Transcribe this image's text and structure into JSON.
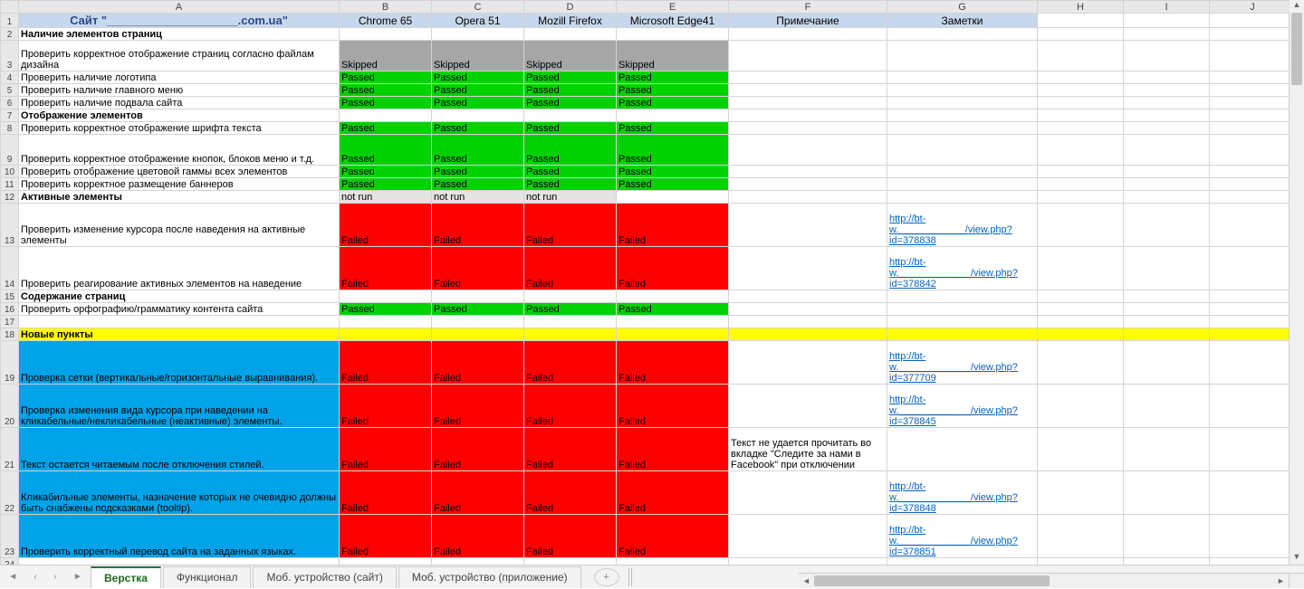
{
  "columns": [
    "A",
    "B",
    "C",
    "D",
    "E",
    "F",
    "G",
    "H",
    "I",
    "J"
  ],
  "header": {
    "title": "Сайт \"____________________.com.ua\"",
    "b": "Chrome 65",
    "c": "Opera  51",
    "d": "Mozill Firefox",
    "e": "Microsoft Edge41",
    "f": "Примечание",
    "g": "Заметки"
  },
  "rows": [
    {
      "n": 2,
      "a": "Наличие элементов страниц",
      "aCls": "bold"
    },
    {
      "n": 3,
      "a": "Проверить корректное отображение страниц согласно файлам дизайна",
      "tall": true,
      "b": "Skipped",
      "c": "Skipped",
      "d": "Skipped",
      "e": "Skipped",
      "bcCls": "gray"
    },
    {
      "n": 4,
      "a": "Проверить наличие логотипа",
      "b": "Passed",
      "c": "Passed",
      "d": "Passed",
      "e": "Passed",
      "bcCls": "green"
    },
    {
      "n": 5,
      "a": "Проверить наличие главного меню",
      "b": "Passed",
      "c": "Passed",
      "d": "Passed",
      "e": "Passed",
      "bcCls": "green"
    },
    {
      "n": 6,
      "a": "Проверить наличие подвала сайта",
      "b": "Passed",
      "c": "Passed",
      "d": "Passed",
      "e": "Passed",
      "bcCls": "green"
    },
    {
      "n": 7,
      "a": "Отображение элементов",
      "aCls": "bold"
    },
    {
      "n": 8,
      "a": "Проверить корректное отображение шрифта текста",
      "b": "Passed",
      "c": "Passed",
      "d": "Passed",
      "e": "Passed",
      "bcCls": "green"
    },
    {
      "n": 9,
      "a": "Проверить корректное отображение кнопок, блоков меню и т.д.",
      "tall": true,
      "b": "Passed",
      "c": "Passed",
      "d": "Passed",
      "e": "Passed",
      "bcCls": "green"
    },
    {
      "n": 10,
      "a": "Проверить отображение цветовой гаммы всех элементов",
      "b": "Passed",
      "c": "Passed",
      "d": "Passed",
      "e": "Passed",
      "bcCls": "green"
    },
    {
      "n": 11,
      "a": "Проверить корректное размещение баннеров",
      "b": "Passed",
      "c": "Passed",
      "d": "Passed",
      "e": "Passed",
      "bcCls": "green"
    },
    {
      "n": 12,
      "a": "Активные элементы",
      "aCls": "bold",
      "b": "not run",
      "c": "not run",
      "d": "not run",
      "bcCls": "ltgray",
      "eCls": ""
    },
    {
      "n": 13,
      "a": "Проверить изменение курсора после наведения на активные элементы",
      "tall2": true,
      "b": "Failed",
      "c": "Failed",
      "d": "Failed",
      "e": "Failed",
      "bcCls": "red",
      "g": "http://bt-w.____________/view.php?id=378838"
    },
    {
      "n": 14,
      "a": "Проверить реагирование активных элементов на наведение",
      "tall2": true,
      "b": "Failed",
      "c": "Failed",
      "d": "Failed",
      "e": "Failed",
      "bcCls": "red",
      "g": "http://bt-w._____________/view.php?id=378842"
    },
    {
      "n": 15,
      "a": "Содержание страниц",
      "aCls": "bold"
    },
    {
      "n": 16,
      "a": "Проверить орфографию/грамматику контента сайта",
      "b": "Passed",
      "c": "Passed",
      "d": "Passed",
      "e": "Passed",
      "bcCls": "green"
    },
    {
      "n": 17,
      "a": ""
    },
    {
      "n": 18,
      "a": "Новые пункты",
      "aCls": "bold",
      "rowCls": "yellow"
    },
    {
      "n": 19,
      "a": "Проверка сетки (вертикальные/горизонтальные выравнивания).",
      "tall2": true,
      "aCls": "blue",
      "b": "Failed",
      "c": "Failed",
      "d": "Failed",
      "e": "Failed",
      "bcCls": "red",
      "g": "http://bt-w._____________/view.php?id=377709"
    },
    {
      "n": 20,
      "a": "Проверка изменения вида курсора при наведении на кликабельные/некликабельные (неактивные) элементы.",
      "tall2": true,
      "aCls": "blue",
      "b": "Failed",
      "c": "Failed",
      "d": "Failed",
      "e": "Failed",
      "bcCls": "red",
      "g": "http://bt-w._____________/view.php?id=378845"
    },
    {
      "n": 21,
      "a": "Текст остается читаемым после отключения стилей.",
      "tall2": true,
      "aCls": "blue",
      "b": "Failed",
      "c": "Failed",
      "d": "Failed",
      "e": "Failed",
      "bcCls": "red",
      "f": "Текст не удается прочитать во вкладке \"Следите за нами в Facebook\" при отключении"
    },
    {
      "n": 22,
      "a": "Кликабильные элементы, назначение которых не очевидно должны быть снабжены подсказками (tooltip).",
      "tall2": true,
      "aCls": "blue",
      "b": "Failed",
      "c": "Failed",
      "d": "Failed",
      "e": "Failed",
      "bcCls": "red",
      "g": "http://bt-w._____________/view.php?id=378848"
    },
    {
      "n": 23,
      "a": "Проверить корректный перевод сайта на заданных языках.",
      "tall2": true,
      "aCls": "blue",
      "b": "Failed",
      "c": "Failed",
      "d": "Failed",
      "e": "Failed",
      "bcCls": "red",
      "g": "http://bt-w._____________/view.php?id=378851",
      "eBottom": true
    },
    {
      "n": 24,
      "a": ""
    }
  ],
  "tabs": [
    {
      "label": "Верстка",
      "active": true
    },
    {
      "label": "Функционал"
    },
    {
      "label": "Моб. устройство (сайт)"
    },
    {
      "label": "Моб. устройство (приложение)"
    }
  ]
}
